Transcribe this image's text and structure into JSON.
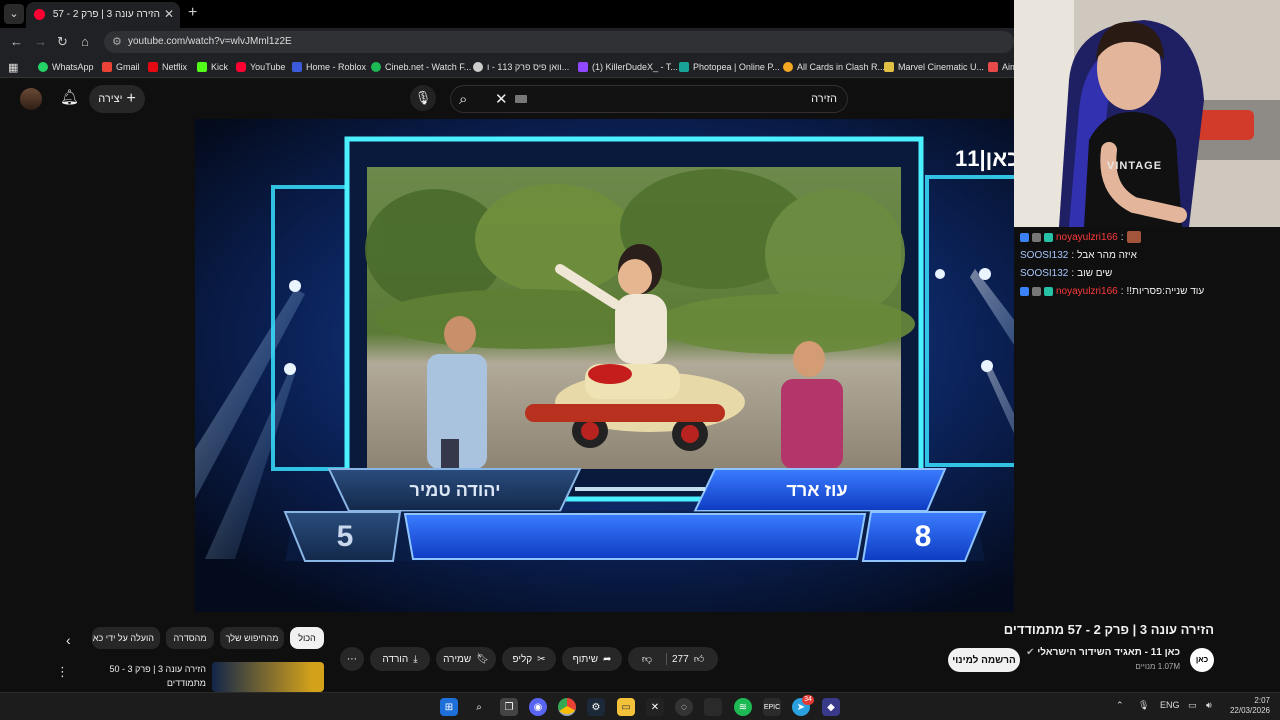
{
  "browser": {
    "tab_title": "הזירה עונה 3 | פרק 2 - 57 מתמודדים",
    "url": "youtube.com/watch?v=wlvJMml1z2E",
    "bookmarks": [
      {
        "label": "WhatsApp",
        "color": "#25d366"
      },
      {
        "label": "Gmail",
        "color": "#ea4335"
      },
      {
        "label": "Netflix",
        "color": "#e50914"
      },
      {
        "label": "Kick",
        "color": "#53fc18"
      },
      {
        "label": "YouTube",
        "color": "#ff0033"
      },
      {
        "label": "Home - Roblox",
        "color": "#3b5bdb"
      },
      {
        "label": "Cineb.net - Watch F...",
        "color": "#1db954"
      },
      {
        "label": "וואן פיס פרק 113 - ו...",
        "color": "#cccccc"
      },
      {
        "label": "(1) KillerDudeX_ - T...",
        "color": "#9146ff"
      },
      {
        "label": "Photopea | Online P...",
        "color": "#18a497"
      },
      {
        "label": "All Cards in Clash R...",
        "color": "#f5a623"
      },
      {
        "label": "Marvel Cinematic U...",
        "color": "#e2c044"
      },
      {
        "label": "Aim",
        "color": "#e84a4a"
      }
    ]
  },
  "youtube": {
    "create_label": "יצירה",
    "search_value": "הזירה",
    "video": {
      "channel_logo": "11|כאן",
      "left_name": "יהודה טמיר",
      "right_name": "עוז ארד",
      "left_score": "5",
      "right_score": "8"
    },
    "title": "הזירה עונה 3 | פרק 2 - 57 מתמודדים",
    "channel_name": "כאן 11 - תאגיד השידור הישראלי",
    "subscribers": "1.07M מנויים",
    "subscribe_label": "הרשמה למינוי",
    "likes": "277",
    "share_label": "שיתוף",
    "clip_label": "קליפ",
    "save_label": "שמירה",
    "download_label": "הורדה",
    "chips": [
      "הכול",
      "מהחיפוש שלך",
      "מהסדרה",
      "הועלה על ידי כאן"
    ],
    "rec_title": "הזירה עונה 3 | פרק 3 - 50 מתמודדים"
  },
  "chat": [
    {
      "user": "noyayulzri166",
      "message": "",
      "user_color": "#ff3b3b",
      "has_badges": true,
      "emote": true
    },
    {
      "user": "SOOSI132",
      "message": "איזה מהר אבל",
      "user_color": "#a9c7ff",
      "has_badges": false,
      "emote": false
    },
    {
      "user": "SOOSI132",
      "message": "שים שוב",
      "user_color": "#a9c7ff",
      "has_badges": false,
      "emote": false
    },
    {
      "user": "noyayulzri166",
      "message": "עוד שנייה:פסריות!!",
      "user_color": "#ff3b3b",
      "has_badges": true,
      "emote": false
    }
  ],
  "webcam": {
    "shirt_text": "VINTAGE"
  },
  "taskbar": {
    "language": "ENG",
    "time": "2:07",
    "date": "22/03/2026",
    "telegram_badge": "34"
  }
}
